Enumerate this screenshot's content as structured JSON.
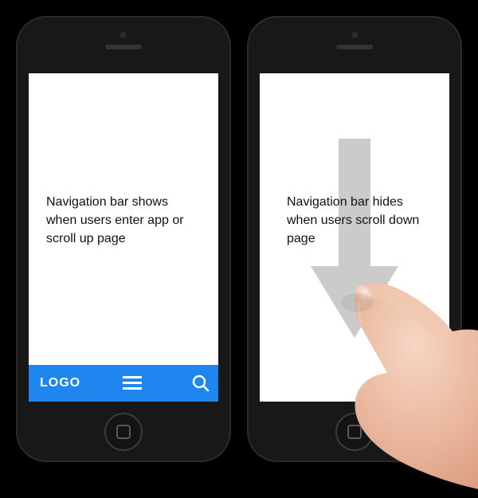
{
  "left_phone": {
    "body_text": "Navigation bar shows when users enter app or scroll up page",
    "navbar": {
      "logo": "LOGO"
    }
  },
  "right_phone": {
    "body_text": "Navigation bar hides when users scroll down page"
  },
  "colors": {
    "navbar_bg": "#1f86f0",
    "arrow_fill": "#c9c9c9"
  }
}
